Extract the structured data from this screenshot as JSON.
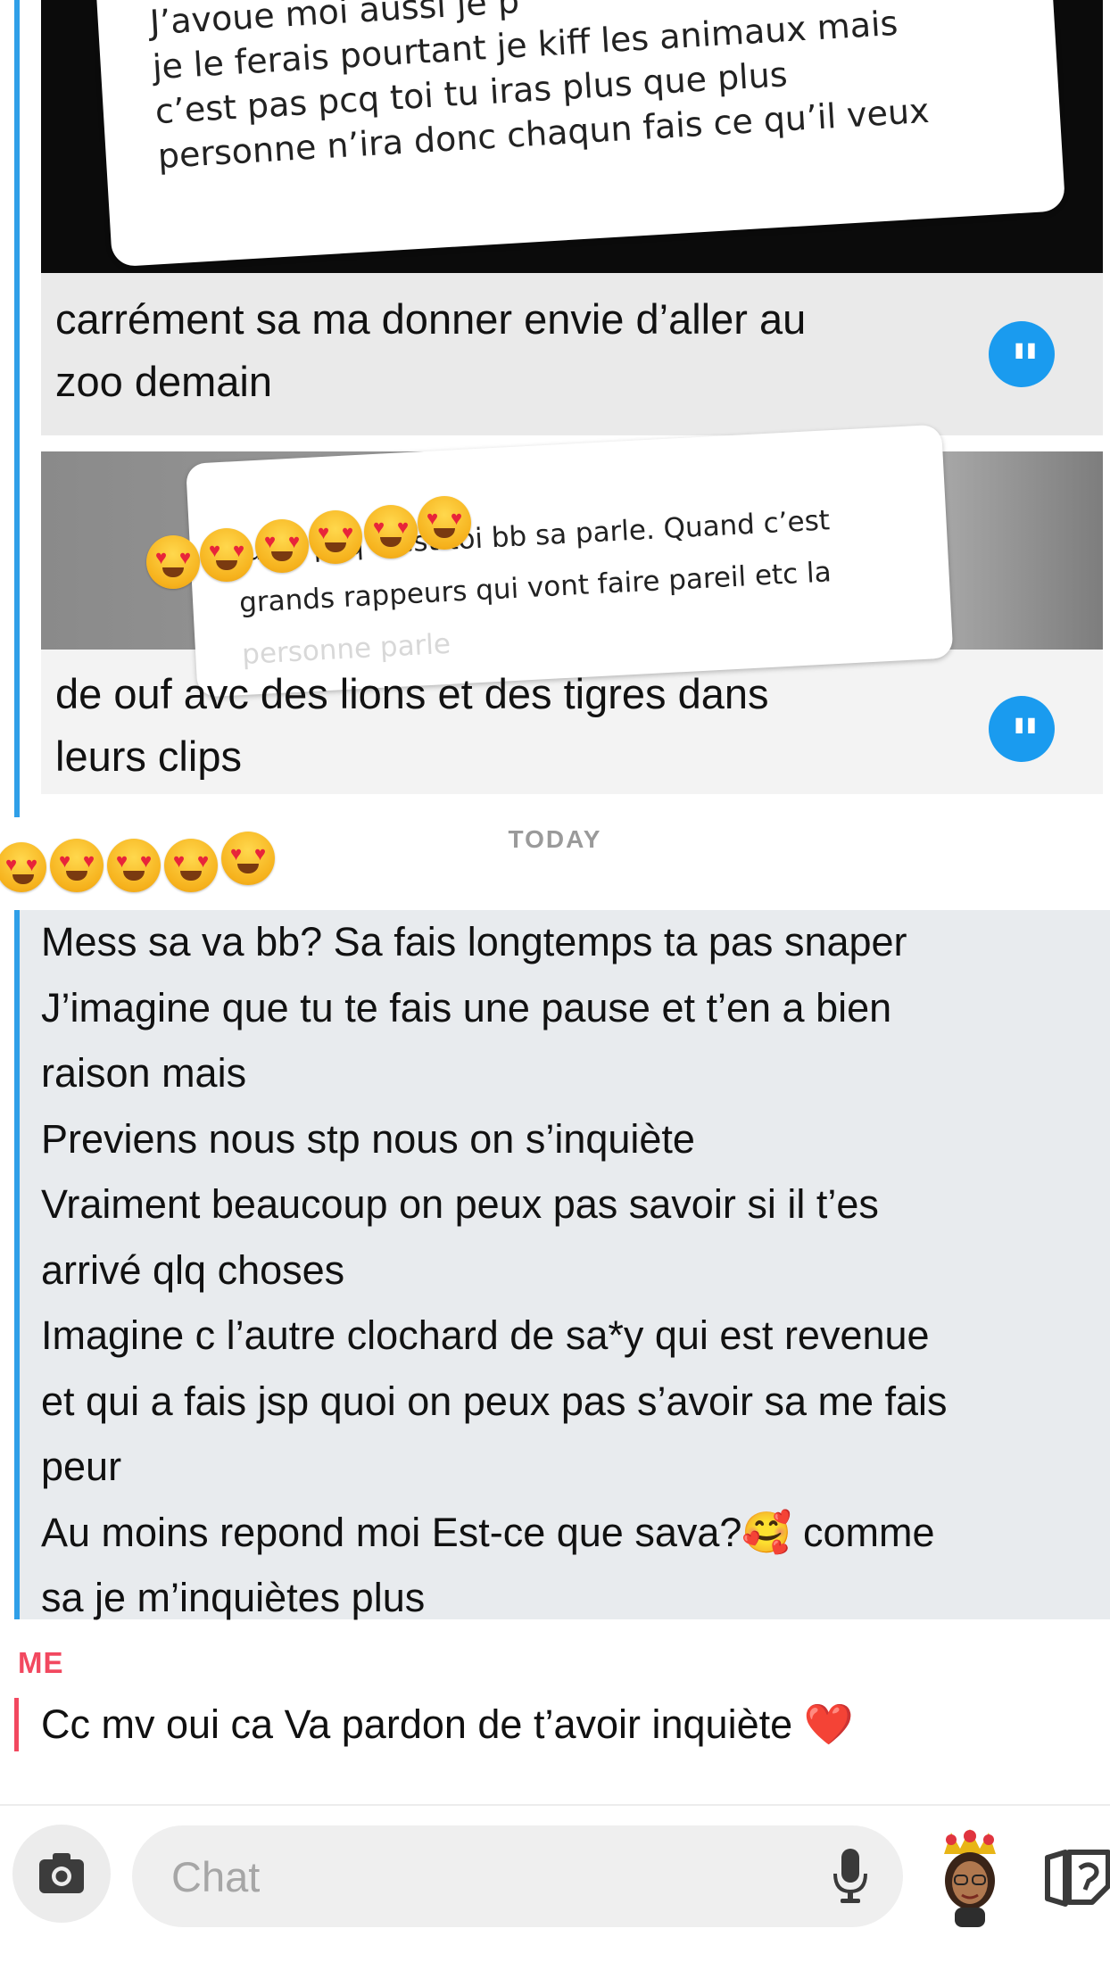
{
  "conversation": {
    "story_reply_1": {
      "sticker_lines": [
        "J’avoue moi aussi je p",
        "je le ferais pourtant je kiff les animaux mais",
        "c’est pas pcq toi tu iras plus que plus",
        "personne n’ira donc chaqun fais ce qu’il veux"
      ],
      "caption_lines": [
        "carrément sa ma donner envie d’aller au",
        "zoo demain"
      ],
      "quote_icon": "quote-icon"
    },
    "story_reply_2": {
      "sticker_lines": [
        "Juste pcq c’est toi bb sa parle. Quand c’est",
        "grands rappeurs qui vont faire pareil etc la",
        "personne parle"
      ],
      "emoji_icon": "heart-eyes-emoji",
      "caption_lines": [
        "de ouf avc des lions et des tigres dans",
        "leurs clips"
      ],
      "quote_icon": "quote-icon"
    },
    "day_divider": "TODAY",
    "sender_emoji_icon": "heart-eyes-emoji",
    "incoming_message": {
      "lines": [
        "Mess sa va bb? Sa fais longtemps ta pas snaper",
        "J’imagine que tu te fais une pause et t’en a bien",
        "raison mais",
        "Previens nous stp nous on s’inquiète",
        "Vraiment beaucoup on peux pas savoir si il t’es",
        "arrivé qlq choses",
        "Imagine c l’autre clochard de sa*y qui est revenue",
        "et qui a fais jsp quoi on peux pas s’avoir sa me fais",
        "peur",
        "Au moins repond moi Est-ce que sava?🥰 comme",
        "sa je m’inquiètes plus"
      ]
    },
    "me_label": "ME",
    "outgoing_message": "Cc mv oui ca Va pardon de t’avoir inquiète ❤️"
  },
  "composer": {
    "camera_icon": "camera-icon",
    "chat_placeholder": "Chat",
    "mic_icon": "microphone-icon",
    "bitmoji_icon": "bitmoji-avatar",
    "sticker_icon": "sticker-icon"
  },
  "colors": {
    "accent_blue": "#2f9fe8",
    "me_red": "#f2485f",
    "quote_blue": "#1a9bef",
    "incoming_bg": "#e8ebee"
  }
}
